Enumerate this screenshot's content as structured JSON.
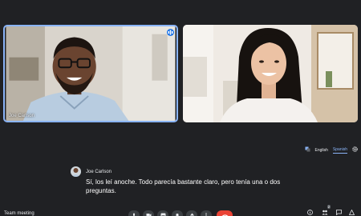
{
  "participants": [
    {
      "name": "Joe Carlson",
      "speaking": true
    },
    {
      "name": "",
      "speaking": false
    }
  ],
  "captions": {
    "languages": [
      "English",
      "Spanish"
    ],
    "selected_language": "Spanish",
    "speaker": "Joe Carlson",
    "text": "Sí, los leí anoche. Todo parecía bastante claro, pero tenía una o dos preguntas."
  },
  "meeting": {
    "title": "Team meeting",
    "participant_count": "2"
  },
  "controls": [
    {
      "icon": "mic-icon"
    },
    {
      "icon": "camera-icon"
    },
    {
      "icon": "captions-icon"
    },
    {
      "icon": "raise-hand-icon"
    },
    {
      "icon": "present-icon"
    },
    {
      "icon": "more-options-icon"
    },
    {
      "icon": "end-call-icon"
    }
  ],
  "right_controls": [
    {
      "icon": "info-icon"
    },
    {
      "icon": "people-icon"
    },
    {
      "icon": "chat-icon"
    },
    {
      "icon": "activities-icon"
    }
  ],
  "colors": {
    "background": "#202124",
    "accent": "#8ab4f8",
    "end_call": "#ea4335",
    "control": "#3c4043"
  }
}
